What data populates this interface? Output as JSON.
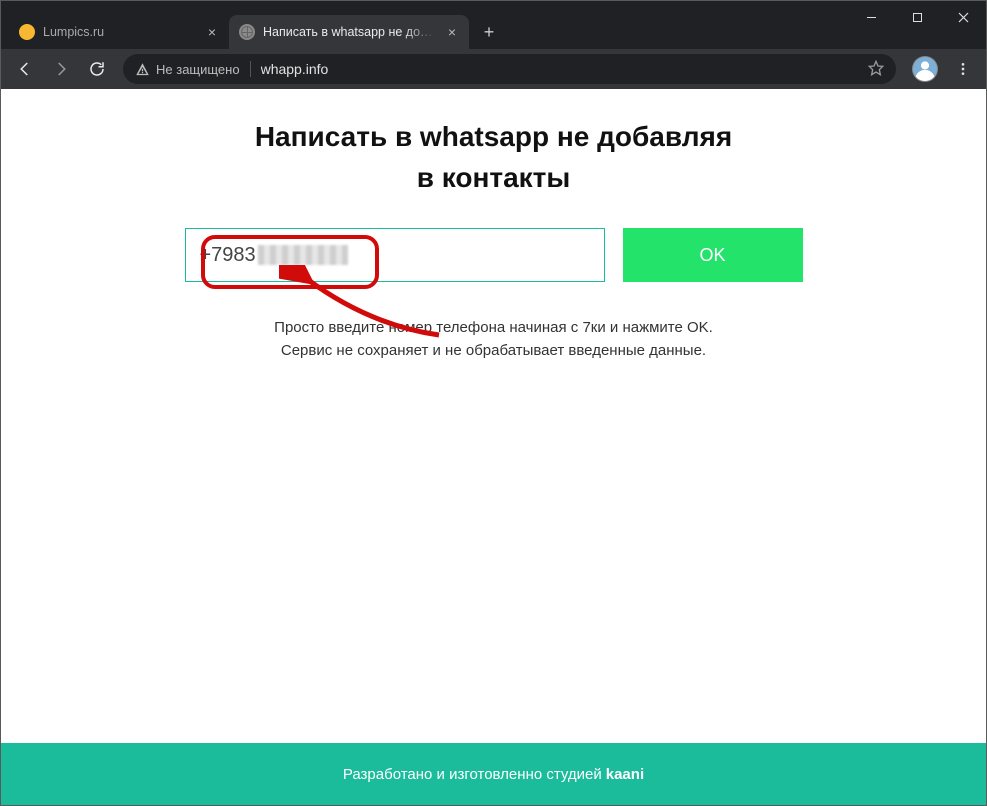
{
  "window": {
    "tabs": [
      {
        "title": "Lumpics.ru",
        "active": false
      },
      {
        "title": "Написать в whatsapp не добавл",
        "active": true
      }
    ]
  },
  "toolbar": {
    "security_label": "Не защищено",
    "url": "whapp.info"
  },
  "page": {
    "heading_line1": "Написать в whatsapp не добавляя",
    "heading_line2": "в контакты",
    "phone_prefix": "+7983",
    "ok_label": "OK",
    "hint_line1": "Просто введите номер телефона начиная с 7ки и нажмите OK.",
    "hint_line2": "Сервис не сохраняет и не обрабатывает введенные данные."
  },
  "footer": {
    "text": "Разработано и изготовленно студией",
    "studio": "kaani"
  }
}
